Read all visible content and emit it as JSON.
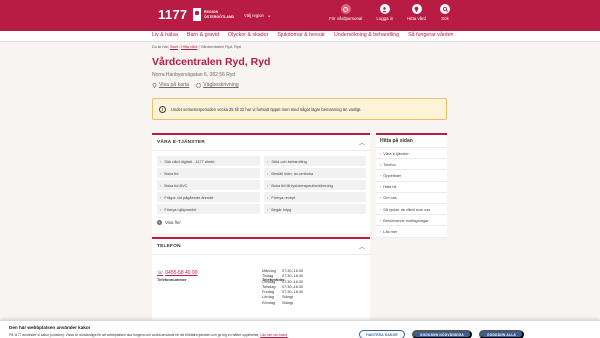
{
  "header": {
    "logo": "1177",
    "region_line1": "REGION",
    "region_line2": "ÖSTERGÖTLAND",
    "pick_region": "Välj region",
    "actions": [
      {
        "label": "För vårdpersonal",
        "icon": "stethoscope-icon"
      },
      {
        "label": "Logga in",
        "icon": "user-icon"
      },
      {
        "label": "Hitta vård",
        "icon": "location-pin-icon"
      },
      {
        "label": "Sök",
        "icon": "search-icon"
      }
    ]
  },
  "nav": {
    "items": [
      "Liv & hälsa",
      "Barn & gravid",
      "Olyckor & skador",
      "Sjukdomar & besvär",
      "Undersökning & behandling",
      "Så fungerar vården"
    ]
  },
  "breadcrumb": {
    "prefix": "Du är här:",
    "start": "Start",
    "find_care": "Hitta vård",
    "current": "Vårdcentralen Ryd, Ryd"
  },
  "page": {
    "title": "Vårdcentralen Ryd, Ryd",
    "address": "Norra Hanbyervägatan 6, 382 56 Ryd",
    "show_on_map": "Visa på karta",
    "directions": "Vägbeskrivning"
  },
  "notice": {
    "text": "Under semesterperioden vecka 25 till 32 har vi fortsatt öppet men med något lägre bemanning än vanligt."
  },
  "eservices": {
    "heading": "VÅRA E-TJÄNSTER",
    "left": [
      "Sök vård digitalt - 1177 direkt",
      "Boka tid",
      "Boka tid BVC",
      "Frågor vid pågående ärende",
      "Förnya hjälpmedel"
    ],
    "right": [
      "Stöd och behandling",
      "Beställ öder, av-omboka",
      "Boka tid till fysioterapeutbedömning",
      "Förnya recept",
      "Begär intyg"
    ],
    "more": "Visa fler"
  },
  "phone": {
    "heading": "TELEFON",
    "col_number": "Telefonnummer",
    "col_hours": "Telefontider",
    "number": "0455-58 40 00",
    "hours": [
      {
        "day": "Måndag",
        "time": "07:30–16:30"
      },
      {
        "day": "Tisdag",
        "time": "07:30–16:30"
      },
      {
        "day": "Onsdag",
        "time": "07:30–16:30"
      },
      {
        "day": "Torsdag",
        "time": "07:30–16:30"
      },
      {
        "day": "Fredag",
        "time": "07:30–16:30"
      },
      {
        "day": "Lördag",
        "time": "Stängt"
      },
      {
        "day": "Söndag",
        "time": "Stängt"
      }
    ]
  },
  "sidebar": {
    "heading": "Hitta på sidan",
    "items": [
      "Våra e-tjänster",
      "Telefon",
      "Öppettider",
      "Hitta hit",
      "Om oss",
      "Så tycker de vårdt som oss",
      "Beskrivande mottagningar",
      "Läs mer"
    ]
  },
  "cookie": {
    "title": "Den här webbplatsen använder kakor",
    "text": "På 1177 använder vi kakor (cookies). Vissa är nödvändiga för att webbplatsen ska fungera och andra används för att förbättra tjänsten och ge dig en bättre upplevelse.",
    "link": "Läs mer om kakor",
    "buttons": [
      "HANTERA KAKOR",
      "GODKÄNN NÖDVÄNDIGA",
      "GODKÄNN ALLA"
    ]
  },
  "colors": {
    "brand": "#b81b43",
    "button_blue": "#396196",
    "notice_bg": "#fdf3d9"
  }
}
